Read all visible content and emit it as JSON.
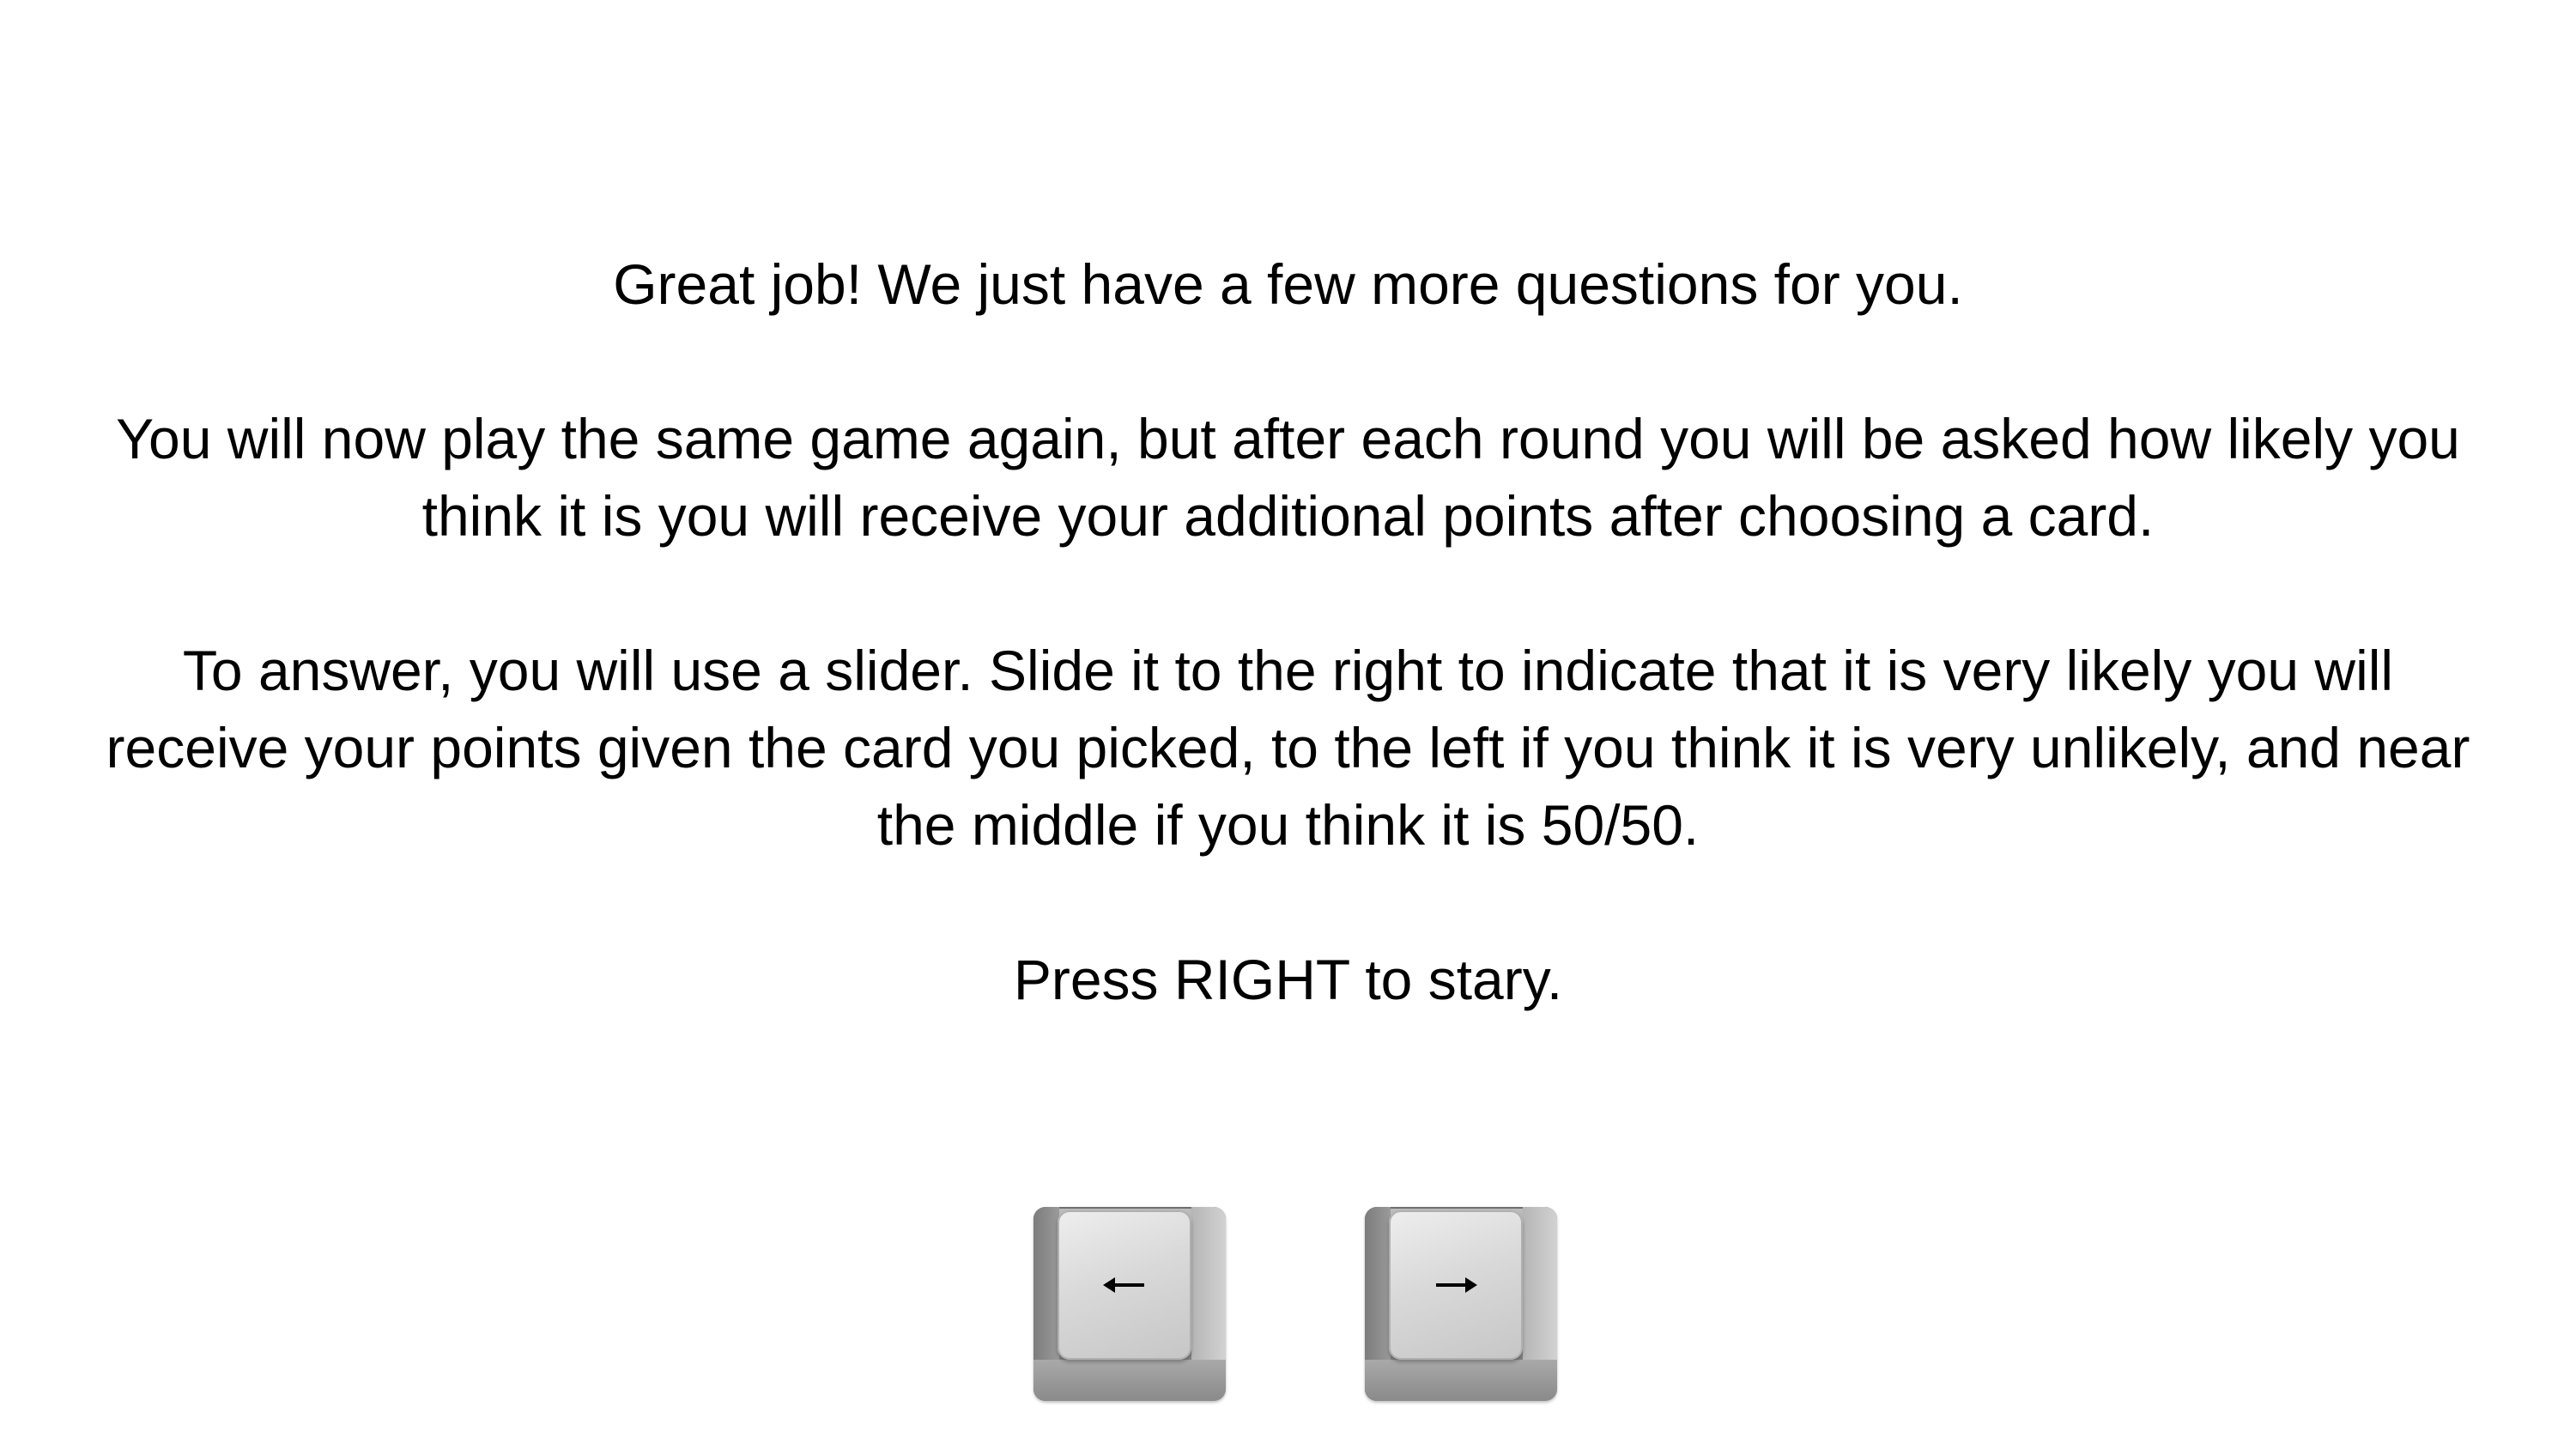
{
  "instructions": {
    "heading": "Great job! We just have a few more questions for you.",
    "paragraph_1_line_1": "You will now play the same game again, but after each round you will be asked how likely you",
    "paragraph_1_line_2": "think it is you will receive your additional points after choosing a card.",
    "paragraph_2_line_1": "To answer, you will use a slider. Slide it to the right to indicate that it is very likely you will",
    "paragraph_2_line_2": "receive your points given the card you picked, to the left if you think it is very unlikely, and near",
    "paragraph_2_line_3": "the middle if you think it is 50/50.",
    "prompt": "Press RIGHT to stary."
  },
  "keys": [
    {
      "name": "left-arrow-key",
      "icon": "arrow-left-icon"
    },
    {
      "name": "right-arrow-key",
      "icon": "arrow-right-icon"
    }
  ],
  "colors": {
    "background": "#ffffff",
    "text": "#000000",
    "key_gray": "#a0a0a0"
  }
}
